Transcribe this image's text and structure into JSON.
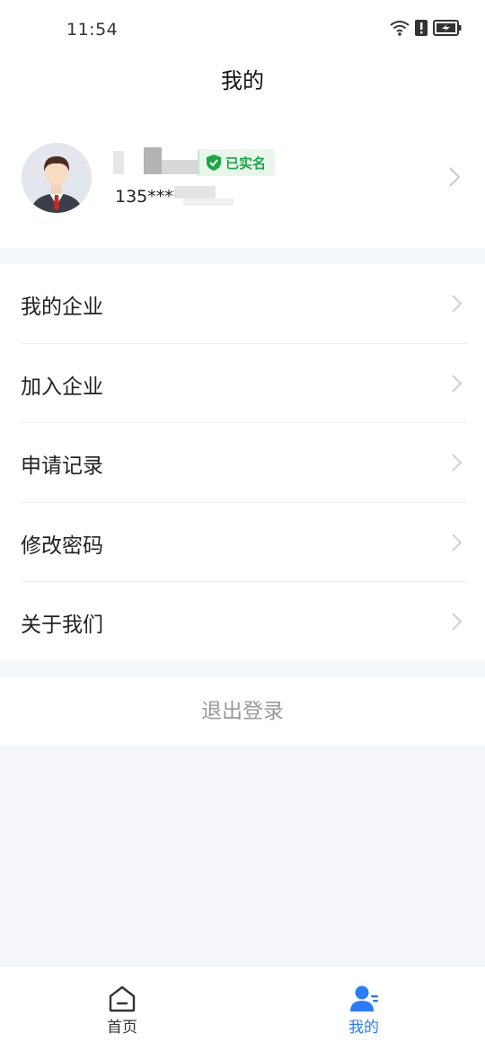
{
  "status_bar": {
    "time": "11:54",
    "icons": [
      "wifi-icon",
      "alert-icon",
      "battery-charging-icon"
    ]
  },
  "header": {
    "title": "我的"
  },
  "profile": {
    "verified_label": "已实名",
    "phone": "135****"
  },
  "menu": {
    "items": [
      {
        "label": "我的企业"
      },
      {
        "label": "加入企业"
      },
      {
        "label": "申请记录"
      },
      {
        "label": "修改密码"
      },
      {
        "label": "关于我们"
      }
    ]
  },
  "logout": {
    "label": "退出登录"
  },
  "tabbar": {
    "tabs": [
      {
        "label": "首页",
        "icon": "home-icon"
      },
      {
        "label": "我的",
        "icon": "user-icon",
        "active": true
      }
    ],
    "active_color": "#2b7cf6"
  },
  "colors": {
    "verified": "#1fa64a",
    "background": "#f5f6fa"
  }
}
